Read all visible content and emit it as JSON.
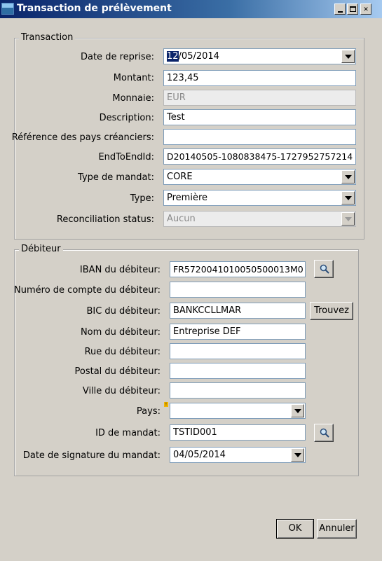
{
  "window": {
    "title": "Transaction de prélèvement"
  },
  "transaction": {
    "legend": "Transaction",
    "date_reprise": {
      "label": "Date de reprise:",
      "value_selected": "12",
      "value_rest": "/05/2014"
    },
    "montant": {
      "label": "Montant:",
      "value": "123,45"
    },
    "monnaie": {
      "label": "Monnaie:",
      "value": "EUR"
    },
    "description": {
      "label": "Description:",
      "value": "Test"
    },
    "reference_pays": {
      "label": "Référence des pays créanciers:",
      "value": ""
    },
    "endtoendid": {
      "label": "EndToEndId:",
      "value": "D20140505-1080838475-1727952757214"
    },
    "type_mandat": {
      "label": "Type de mandat:",
      "value": "CORE"
    },
    "type": {
      "label": "Type:",
      "value": "Première"
    },
    "reconciliation": {
      "label": "Reconciliation status:",
      "value": "Aucun"
    }
  },
  "debiteur": {
    "legend": "Débiteur",
    "iban": {
      "label": "IBAN du débiteur:",
      "value": "FR5720041010050500013M0"
    },
    "numero_compte": {
      "label": "Numéro de compte du débiteur:",
      "value": ""
    },
    "bic": {
      "label": "BIC du débiteur:",
      "value": "BANKCCLLMAR",
      "button": "Trouvez"
    },
    "nom": {
      "label": "Nom du débiteur:",
      "value": "Entreprise DEF"
    },
    "rue": {
      "label": "Rue du débiteur:",
      "value": ""
    },
    "postal": {
      "label": "Postal du débiteur:",
      "value": ""
    },
    "ville": {
      "label": "Ville du débiteur:",
      "value": ""
    },
    "pays": {
      "label": "Pays:",
      "value": ""
    },
    "id_mandat": {
      "label": "ID de mandat:",
      "value": "TSTID001"
    },
    "date_signature": {
      "label": "Date de signature du mandat:",
      "value": "04/05/2014"
    }
  },
  "footer": {
    "ok": "OK",
    "annuler": "Annuler"
  },
  "icons": {
    "app": "window-app-icon",
    "search": "magnifier-icon",
    "warning": "warning-icon"
  }
}
